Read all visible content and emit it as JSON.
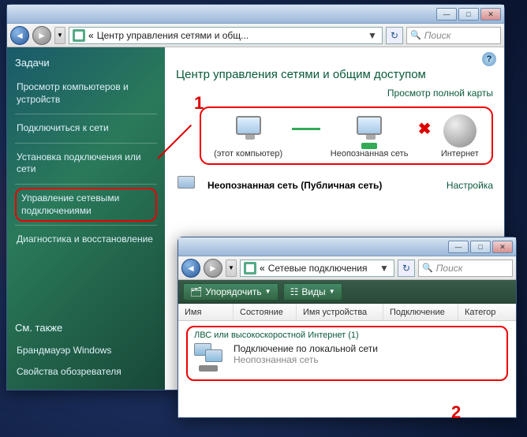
{
  "win1": {
    "address_prefix": "«",
    "address": "Центр управления сетями и общ...",
    "search_placeholder": "Поиск",
    "sidebar": {
      "header": "Задачи",
      "tasks": [
        "Просмотр компьютеров и устройств",
        "Подключиться к сети",
        "Установка подключения или сети",
        "Управление сетевыми подключениями",
        "Диагностика и восстановление"
      ],
      "seealso_header": "См. также",
      "seealso": [
        "Брандмауэр Windows",
        "Свойства обозревателя"
      ]
    },
    "content": {
      "title": "Центр управления сетями и общим доступом",
      "full_map": "Просмотр полной карты",
      "nodes": [
        "(этот компьютер)",
        "Неопознанная сеть",
        "Интернет"
      ],
      "status_text": "Неопознанная сеть (Публичная сеть)",
      "customize": "Настройка"
    }
  },
  "win2": {
    "address": "Сетевые подключения",
    "search_placeholder": "Поиск",
    "toolbar": {
      "organize": "Упорядочить",
      "views": "Виды"
    },
    "columns": [
      "Имя",
      "Состояние",
      "Имя устройства",
      "Подключение",
      "Категор"
    ],
    "group_header": "ЛВС или высокоскоростной Интернет (1)",
    "item": {
      "name": "Подключение по локальной сети",
      "status": "Неопознанная сеть"
    }
  },
  "annotations": {
    "a1": "1",
    "a2": "2"
  }
}
